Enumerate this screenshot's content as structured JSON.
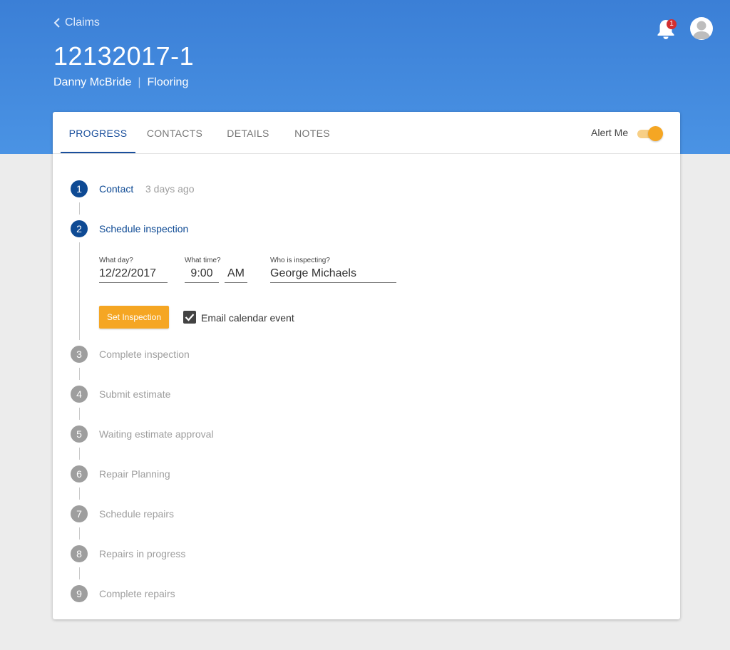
{
  "header": {
    "back_label": "Claims",
    "claim_number": "12132017-1",
    "customer_name": "Danny McBride",
    "category": "Flooring",
    "notification_count": "1"
  },
  "tabs": [
    "PROGRESS",
    "CONTACTS",
    "DETAILS",
    "NOTES"
  ],
  "alert": {
    "label": "Alert Me",
    "enabled": true
  },
  "steps": [
    {
      "number": "1",
      "label": "Contact",
      "meta": "3 days ago",
      "state": "done"
    },
    {
      "number": "2",
      "label": "Schedule inspection",
      "state": "active"
    },
    {
      "number": "3",
      "label": "Complete inspection",
      "state": "todo"
    },
    {
      "number": "4",
      "label": "Submit estimate",
      "state": "todo"
    },
    {
      "number": "5",
      "label": "Waiting estimate approval",
      "state": "todo"
    },
    {
      "number": "6",
      "label": "Repair Planning",
      "state": "todo"
    },
    {
      "number": "7",
      "label": "Schedule repairs",
      "state": "todo"
    },
    {
      "number": "8",
      "label": "Repairs in progress",
      "state": "todo"
    },
    {
      "number": "9",
      "label": "Complete repairs",
      "state": "todo"
    }
  ],
  "inspection_form": {
    "day_label": "What day?",
    "day_value": "12/22/2017",
    "time_label": "What time?",
    "time_value": "9:00",
    "ampm_value": "AM",
    "inspector_label": "Who is inspecting?",
    "inspector_value": "George Michaels",
    "set_button": "Set Inspection",
    "email_checkbox_label": "Email calendar event",
    "email_checked": true
  },
  "colors": {
    "header_blue": "#4a93e4",
    "primary": "#0e4a94",
    "accent": "#f5a623",
    "badge": "#d32f2f",
    "inactive": "#9e9e9e"
  },
  "icons": {
    "back": "chevron-left-icon",
    "notifications": "bell-icon",
    "account": "user-avatar-icon",
    "checkbox": "check-icon"
  }
}
